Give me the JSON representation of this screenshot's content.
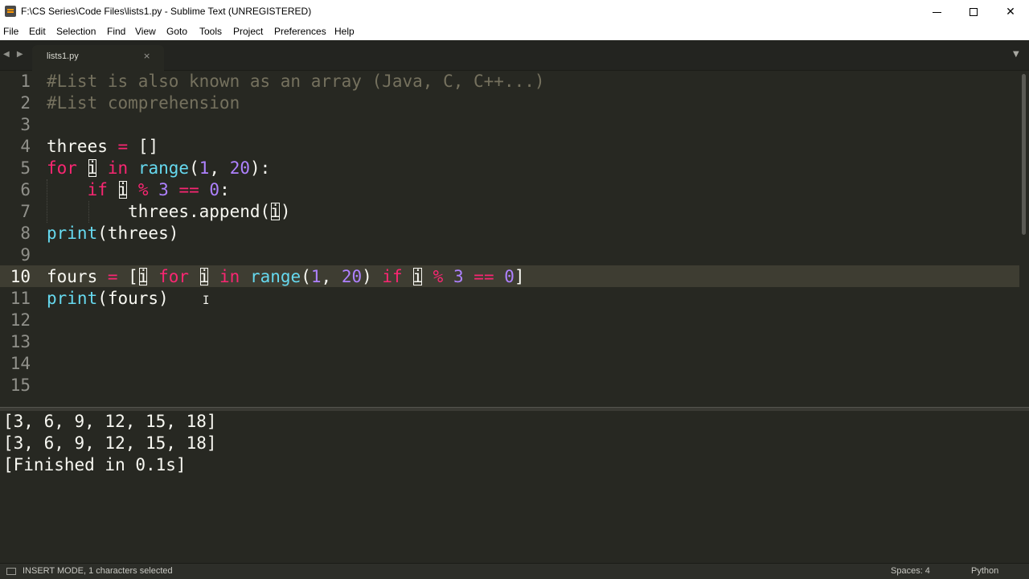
{
  "window": {
    "title": "F:\\CS Series\\Code Files\\lists1.py - Sublime Text (UNREGISTERED)",
    "close_glyph": "✕"
  },
  "menu": [
    "File",
    "Edit",
    "Selection",
    "Find",
    "View",
    "Goto",
    "Tools",
    "Project",
    "Preferences",
    "Help"
  ],
  "tabs": [
    {
      "label": "lists1.py",
      "close": "×"
    }
  ],
  "tab_nav": "◀ ▶",
  "tab_dropdown": "▼",
  "editor": {
    "current_line": 10,
    "line_numbers": [
      "1",
      "2",
      "3",
      "4",
      "5",
      "6",
      "7",
      "8",
      "9",
      "10",
      "11",
      "12",
      "13",
      "14",
      "15"
    ],
    "lines": [
      "#List is also known as an array (Java, C, C++...)",
      "#List comprehension",
      "",
      "threes = []",
      "for i in range(1, 20):",
      "    if i % 3 == 0:",
      "        threes.append(i)",
      "print(threes)",
      "",
      "fours = [i for i in range(1, 20) if i % 3 == 0]",
      "print(fours)",
      "",
      "",
      "",
      ""
    ],
    "cursor_glyph": "I"
  },
  "output": {
    "lines": [
      "[3, 6, 9, 12, 15, 18]",
      "[3, 6, 9, 12, 15, 18]",
      "[Finished in 0.1s]"
    ]
  },
  "status": {
    "mode": "INSERT MODE, 1 characters selected",
    "indent": "Spaces: 4",
    "syntax": "Python"
  },
  "colors": {
    "background": "#272822",
    "comment": "#75715e",
    "keyword": "#f92672",
    "function": "#66d9ef",
    "number": "#ae81ff",
    "text": "#f8f8f2"
  }
}
